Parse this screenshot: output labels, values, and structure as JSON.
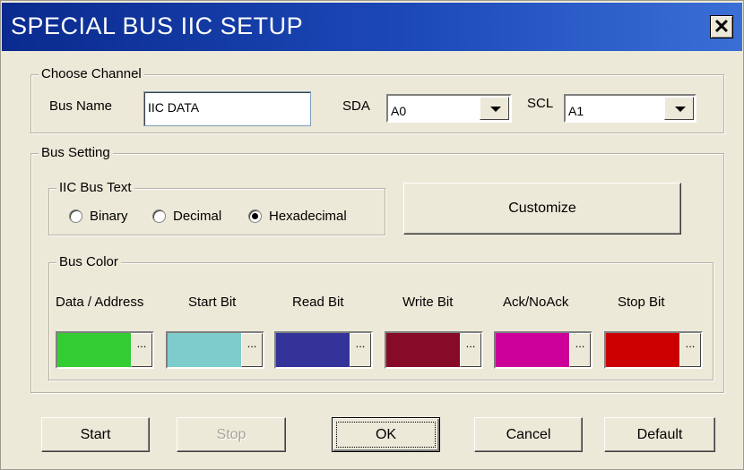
{
  "window": {
    "title": "SPECIAL BUS IIC SETUP",
    "close_label": "✕"
  },
  "channel": {
    "legend": "Choose Channel",
    "bus_name_label": "Bus Name",
    "bus_name_value": "IIC DATA",
    "sda_label": "SDA",
    "sda_value": "A0",
    "scl_label": "SCL",
    "scl_value": "A1"
  },
  "bus_setting": {
    "legend": "Bus Setting",
    "text_group": {
      "legend": "IIC Bus Text",
      "options": [
        "Binary",
        "Decimal",
        "Hexadecimal"
      ],
      "selected": "Hexadecimal"
    },
    "customize_label": "Customize",
    "color_group": {
      "legend": "Bus Color",
      "items": [
        {
          "label": "Data / Address",
          "color": "#33cc33"
        },
        {
          "label": "Start Bit",
          "color": "#7fcccc"
        },
        {
          "label": "Read Bit",
          "color": "#333399"
        },
        {
          "label": "Write Bit",
          "color": "#870a28"
        },
        {
          "label": "Ack/NoAck",
          "color": "#cc0099"
        },
        {
          "label": "Stop Bit",
          "color": "#cc0000"
        }
      ],
      "more_label": "..."
    }
  },
  "buttons": {
    "start": "Start",
    "stop": "Stop",
    "ok": "OK",
    "cancel": "Cancel",
    "default": "Default"
  }
}
